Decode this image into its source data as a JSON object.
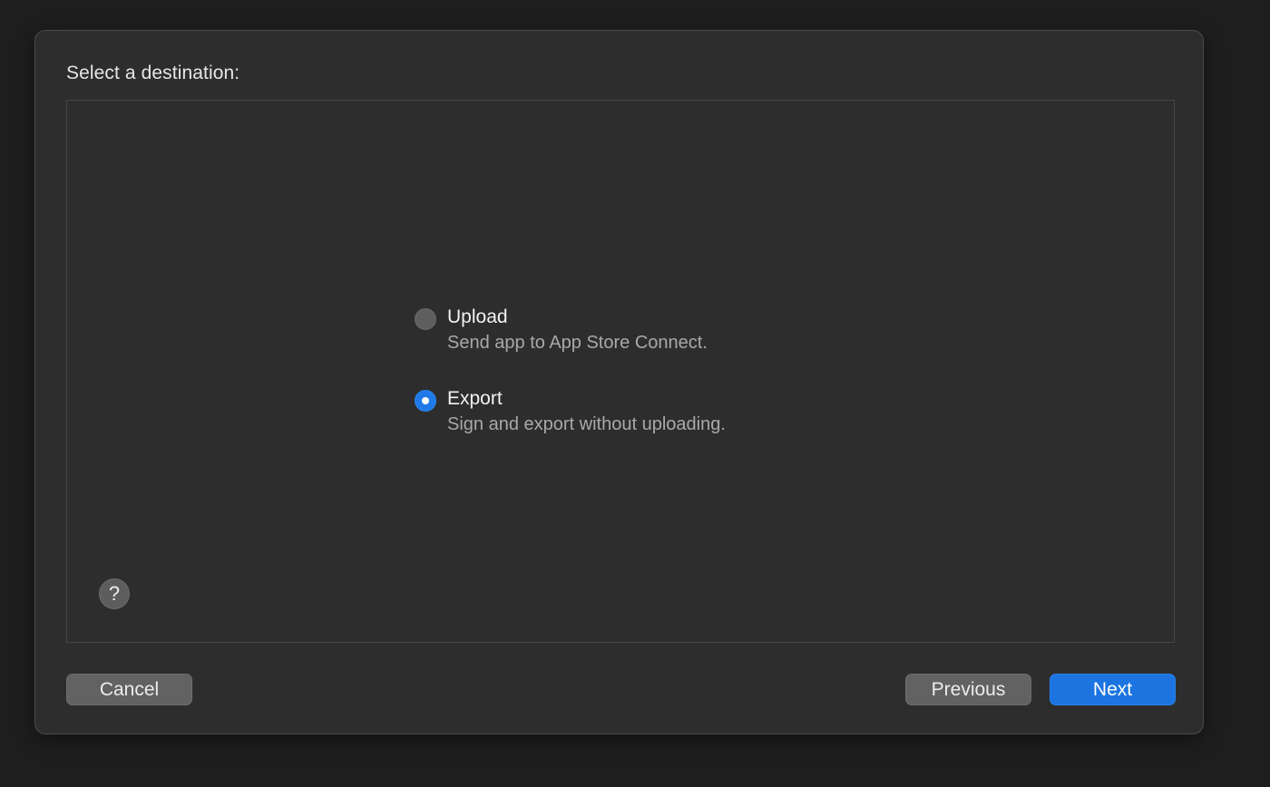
{
  "dialog": {
    "heading": "Select a destination:",
    "options": [
      {
        "title": "Upload",
        "description": "Send app to App Store Connect.",
        "selected": false
      },
      {
        "title": "Export",
        "description": "Sign and export without uploading.",
        "selected": true
      }
    ],
    "help_glyph": "?",
    "buttons": {
      "cancel": "Cancel",
      "previous": "Previous",
      "next": "Next"
    }
  },
  "colors": {
    "background": "#1e1e1e",
    "sheet": "#2d2d2d",
    "accent": "#1b74e0"
  },
  "icons": {
    "help": "question-mark-icon",
    "radio": "radio-button-icon"
  }
}
